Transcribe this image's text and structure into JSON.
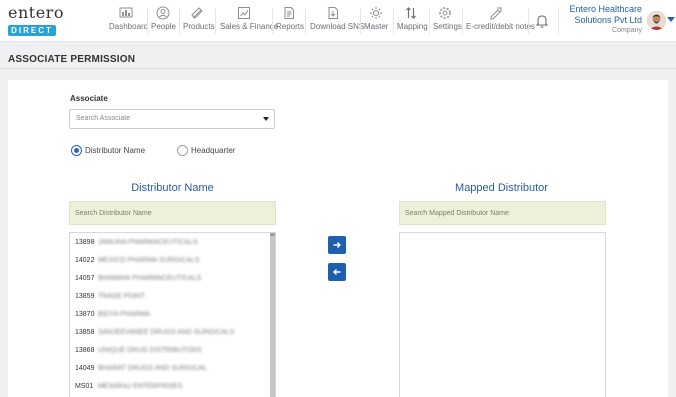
{
  "brand": {
    "logo_top": "entero",
    "logo_bottom": "DIRECT",
    "accent": "#27a3d8"
  },
  "nav": [
    {
      "label": "Dashboard",
      "icon": "dashboard-icon"
    },
    {
      "label": "People",
      "icon": "person-icon"
    },
    {
      "label": "Products",
      "icon": "products-icon"
    },
    {
      "label": "Sales & Finance",
      "icon": "sales-finance-icon"
    },
    {
      "label": "Reports",
      "icon": "reports-icon"
    },
    {
      "label": "Download SNS",
      "icon": "download-icon"
    },
    {
      "label": "Master",
      "icon": "master-icon"
    },
    {
      "label": "Mapping",
      "icon": "mapping-arrows-icon"
    },
    {
      "label": "Settings",
      "icon": "gear-icon"
    },
    {
      "label": "E-credit/debit notes",
      "icon": "notes-icon"
    }
  ],
  "user": {
    "company_line1": "Entero Healthcare",
    "company_line2": "Solutions Pvt Ltd",
    "role": "Company"
  },
  "page": {
    "title": "ASSOCIATE PERMISSION"
  },
  "form": {
    "associate_label": "Associate",
    "associate_placeholder": "Search Associate",
    "radio_distributor": "Distributor Name",
    "radio_headquarter": "Headquarter",
    "selected_radio": "distributor"
  },
  "left_panel": {
    "title": "Distributor Name",
    "search_placeholder": "Search Distributor Name",
    "rows": [
      {
        "code": "13898",
        "name": "JAMUNA PHARMACEUTICALS"
      },
      {
        "code": "14022",
        "name": "MEXICO PHARMA SURGICALS"
      },
      {
        "code": "14057",
        "name": "BHAWANI PHARMACEUTICALS"
      },
      {
        "code": "13859",
        "name": "TRADE POINT"
      },
      {
        "code": "13870",
        "name": "BIDYA PHARMA"
      },
      {
        "code": "13858",
        "name": "SANJEEVANEE DRUGS AND SURGICALS"
      },
      {
        "code": "13868",
        "name": "UNIQUE DRUG DISTRIBUTORS"
      },
      {
        "code": "14049",
        "name": "BHARAT DRUGS AND SURGICAL"
      },
      {
        "code": "MS01",
        "name": "MESARAJ ENTERPRISES"
      }
    ]
  },
  "right_panel": {
    "title": "Mapped Distributor",
    "search_placeholder": "Search Mapped Distributor Name",
    "rows": []
  },
  "colors": {
    "primary": "#1f5fad",
    "heading": "#2b5ca0",
    "search_bg": "#eef1d9"
  }
}
